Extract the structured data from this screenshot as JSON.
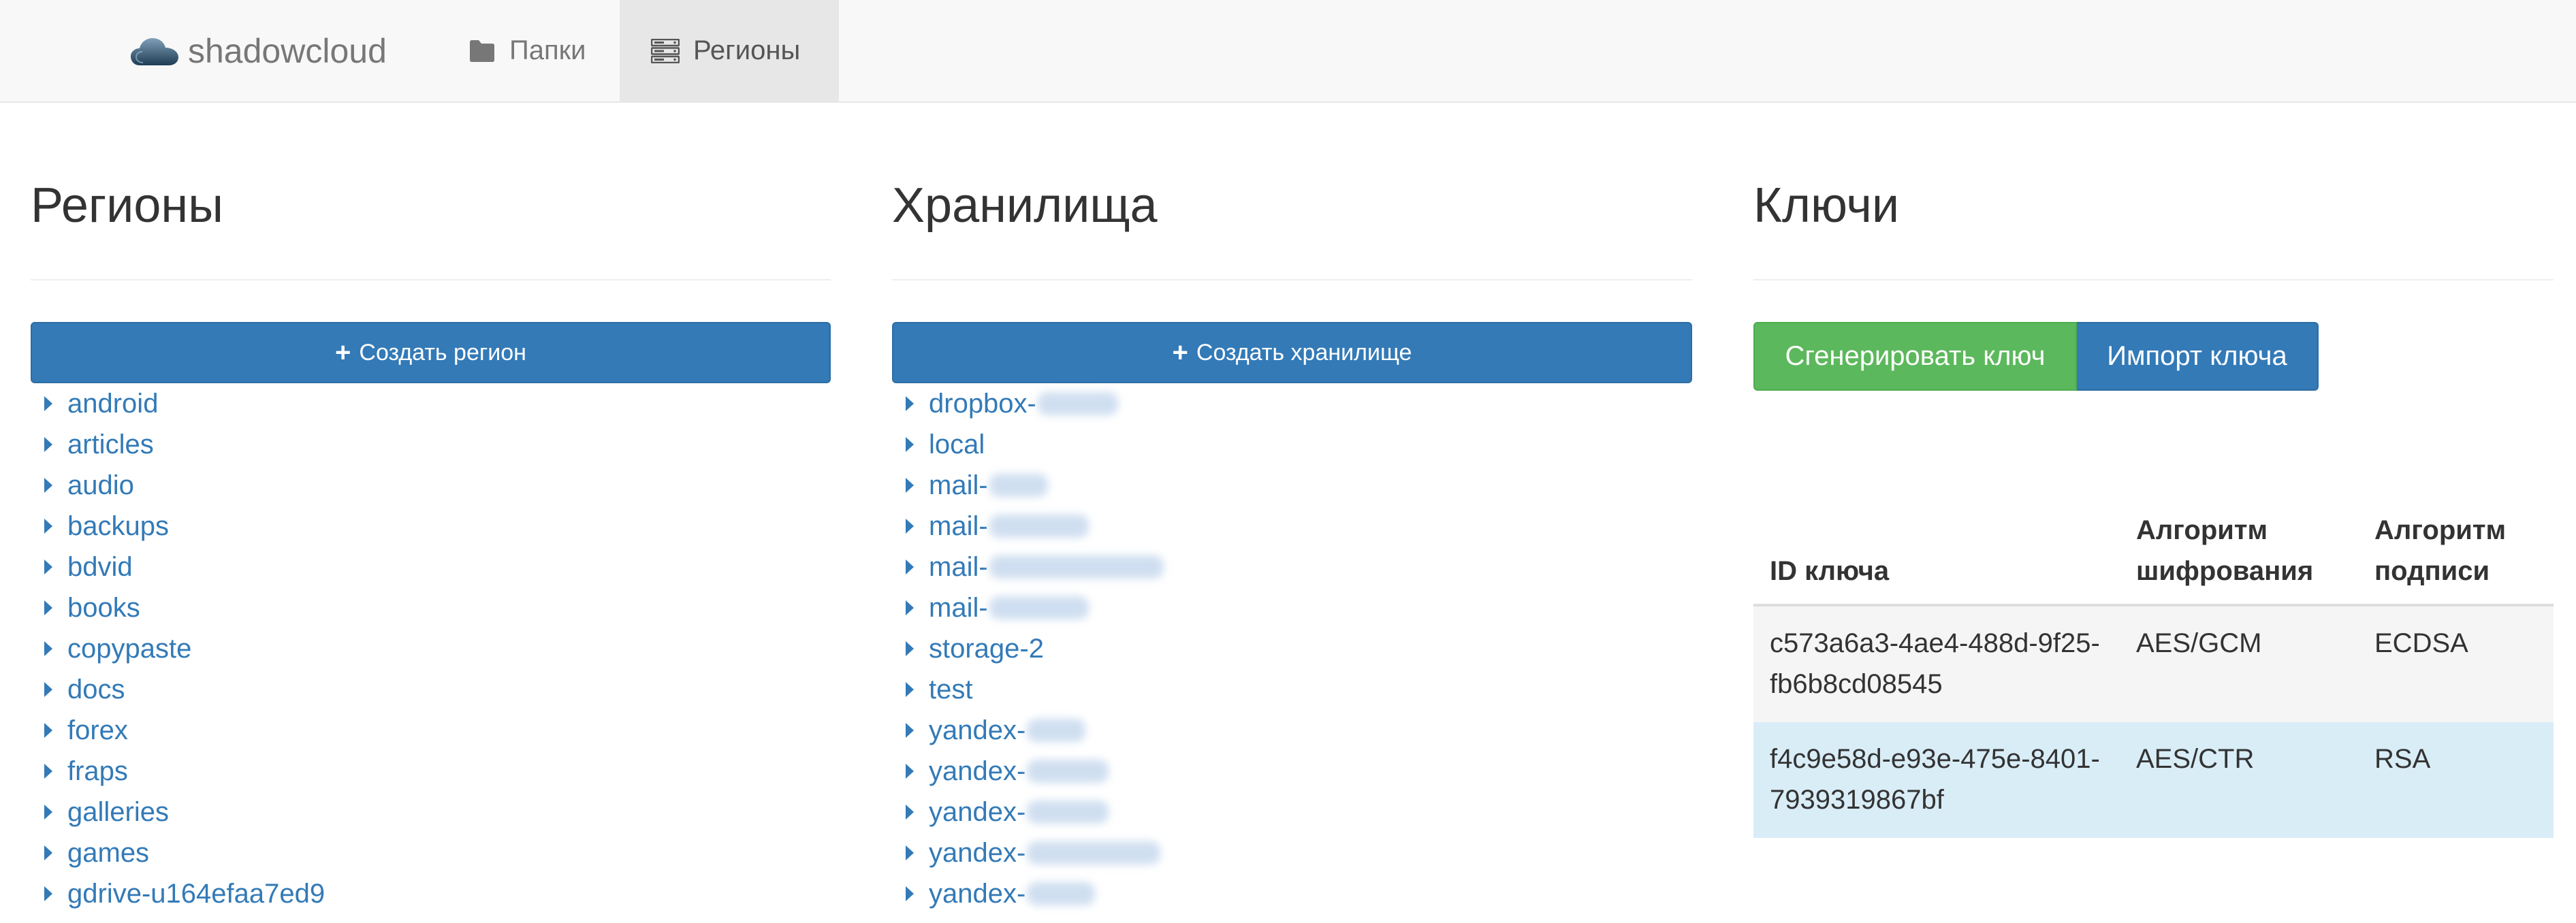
{
  "navbar": {
    "brand": "shadowcloud",
    "items": [
      {
        "label": "Папки",
        "icon": "folder-icon",
        "active": false
      },
      {
        "label": "Регионы",
        "icon": "server-icon",
        "active": true
      }
    ]
  },
  "regions": {
    "title": "Регионы",
    "create_label": "Создать регион",
    "items": [
      "android",
      "articles",
      "audio",
      "backups",
      "bdvid",
      "books",
      "copypaste",
      "docs",
      "forex",
      "fraps",
      "galleries",
      "games",
      "gdrive-u164efaa7ed9"
    ]
  },
  "storages": {
    "title": "Хранилища",
    "create_label": "Создать хранилище",
    "items": [
      "dropbox-",
      "local",
      "mail-",
      "mail-",
      "mail-",
      "mail-",
      "storage-2",
      "test",
      "yandex-",
      "yandex-",
      "yandex-",
      "yandex-",
      "yandex-"
    ]
  },
  "keys": {
    "title": "Ключи",
    "generate_label": "Сгенерировать ключ",
    "import_label": "Импорт ключа",
    "headers": [
      "ID ключа",
      "Алгоритм шифрования",
      "Алгоритм подписи"
    ],
    "rows": [
      {
        "id": "c573a6a3-4ae4-488d-9f25-fb6b8cd08545",
        "encryption": "AES/GCM",
        "signature": "ECDSA"
      },
      {
        "id": "f4c9e58d-e93e-475e-8401-7939319867bf",
        "encryption": "AES/CTR",
        "signature": "RSA"
      }
    ]
  },
  "colors": {
    "primary": "#337ab7",
    "success": "#5cb85c",
    "navbar_bg": "#f8f8f8",
    "row_info": "#d9edf7"
  }
}
